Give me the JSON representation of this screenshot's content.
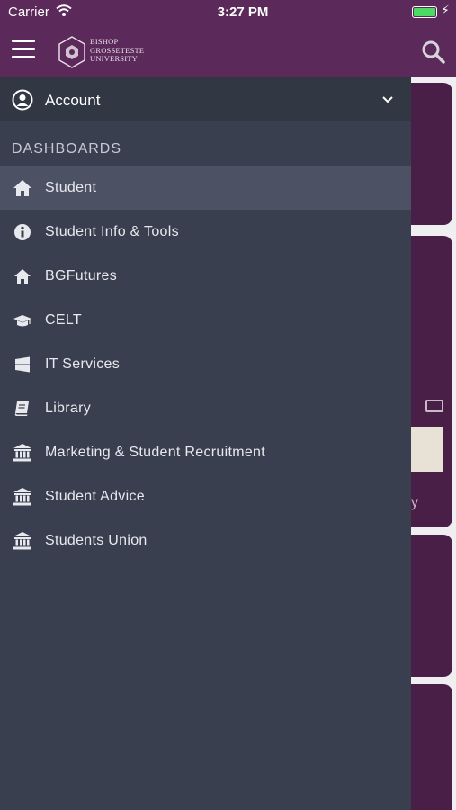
{
  "status_bar": {
    "carrier": "Carrier",
    "time": "3:27 PM",
    "battery_level": 1.0
  },
  "header": {
    "logo_lines": [
      "BISHOP",
      "GROSSETESTE",
      "UNIVERSITY"
    ],
    "brand_color": "#5b2a5a"
  },
  "account": {
    "label": "Account",
    "icon": "user-circle-icon"
  },
  "section": {
    "title": "DASHBOARDS"
  },
  "menu": {
    "items": [
      {
        "label": "Student",
        "icon": "home-icon",
        "active": true
      },
      {
        "label": "Student Info & Tools",
        "icon": "info-icon"
      },
      {
        "label": "BGFutures",
        "icon": "home-icon"
      },
      {
        "label": "CELT",
        "icon": "graduation-cap-icon"
      },
      {
        "label": "IT Services",
        "icon": "windows-icon"
      },
      {
        "label": "Library",
        "icon": "book-icon"
      },
      {
        "label": "Marketing & Student Recruitment",
        "icon": "institution-icon"
      },
      {
        "label": "Student Advice",
        "icon": "institution-icon"
      },
      {
        "label": "Students Union",
        "icon": "institution-icon"
      }
    ]
  },
  "background": {
    "partial_text": "y"
  }
}
